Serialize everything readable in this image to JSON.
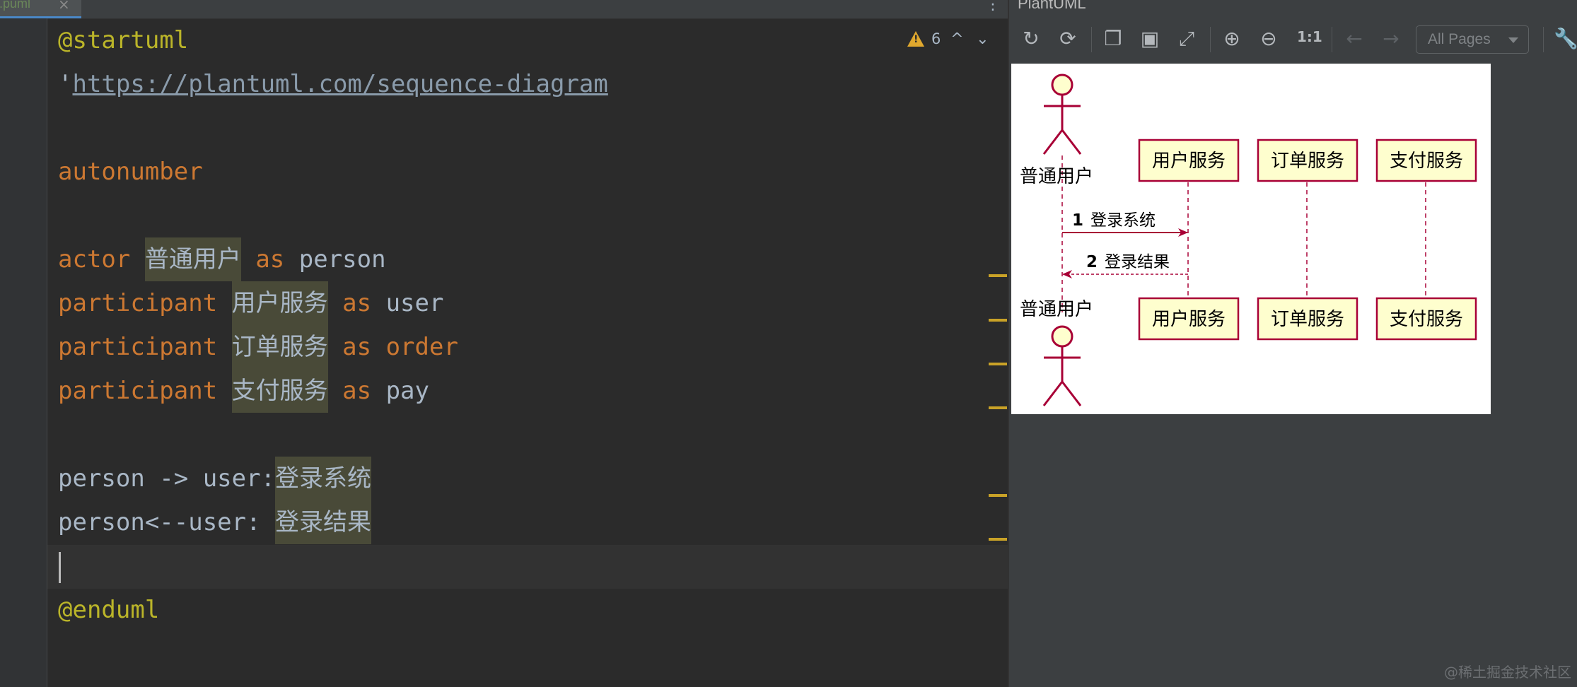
{
  "editor": {
    "tab": {
      "filename": "t.puml",
      "close_glyph": "×"
    },
    "more_glyph": "⋮",
    "inspection": {
      "warning_count": "6",
      "prev_glyph": "^",
      "next_glyph": "⌄"
    },
    "code": {
      "start": "@startuml",
      "quote": "'",
      "url": "https://plantuml.com/sequence-diagram",
      "autonumber": "autonumber",
      "actor_kw": "actor",
      "participant_kw": "participant",
      "as_kw": "as",
      "actor_name": "普通用户",
      "actor_alias": "person",
      "p1_name": "用户服务",
      "p1_alias": "user",
      "p2_name": "订单服务",
      "p2_alias": "order",
      "p3_name": "支付服务",
      "p3_alias": "pay",
      "msg1_prefix": "person -> user:",
      "msg1_text": "登录系统",
      "msg2_prefix": "person<--user: ",
      "msg2_text": "登录结果",
      "end": "@enduml"
    }
  },
  "plantuml": {
    "title": "PlantUML",
    "toolbar": {
      "refresh_icon": "↻",
      "sync_icon": "⟳",
      "copy_icon": "❐",
      "save_icon": "▣",
      "external_icon": "⤢",
      "zoom_in_icon": "⊕",
      "zoom_out_icon": "⊖",
      "zoom_actual": "1:1",
      "back_icon": "←",
      "forward_icon": "→",
      "pages": "All Pages",
      "settings_icon": "🔧"
    },
    "diagram": {
      "actor": "普通用户",
      "participants": [
        "用户服务",
        "订单服务",
        "支付服务"
      ],
      "messages": [
        {
          "number": "1",
          "text": "登录系统"
        },
        {
          "number": "2",
          "text": "登录结果"
        }
      ]
    }
  },
  "watermark": "@稀土掘金技术社区",
  "colors": {
    "keyword": "#cc7832",
    "annotation": "#bbb529",
    "participant_fill": "#fefece",
    "participant_border": "#a80036"
  }
}
